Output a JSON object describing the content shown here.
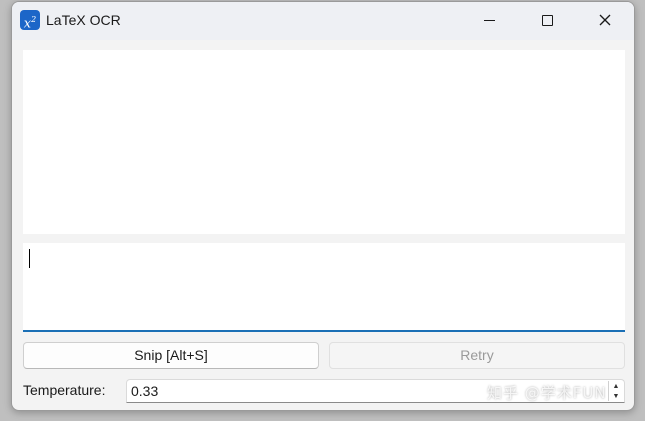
{
  "window": {
    "title": "LaTeX OCR",
    "app_icon": "x-squared-icon",
    "app_icon_text": "x",
    "app_icon_sup": "2"
  },
  "controls": {
    "minimize": "minimize-icon",
    "maximize": "maximize-icon",
    "close_glyph": "✕"
  },
  "output": {
    "latex_value": ""
  },
  "buttons": {
    "snip_label": "Snip [Alt+S]",
    "retry_label": "Retry",
    "retry_enabled": false
  },
  "temperature": {
    "label": "Temperature:",
    "value": "0.33",
    "up_glyph": "▲",
    "down_glyph": "▼"
  },
  "watermark": {
    "text": "知乎 @学术FUN"
  },
  "colors": {
    "accent": "#1a6fb5",
    "icon_bg": "#1c66c8"
  }
}
